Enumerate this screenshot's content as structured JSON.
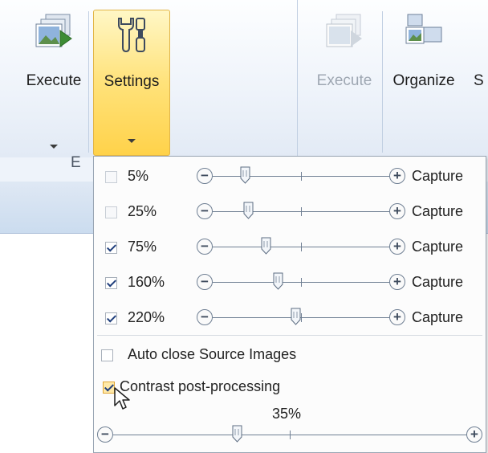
{
  "ribbon": {
    "execute_label": "Execute",
    "settings_label": "Settings",
    "execute2_label": "Execute",
    "organize_label": "Organize",
    "partial_label": "S",
    "group_label_partial": "E"
  },
  "dropdown": {
    "rows": [
      {
        "checked": false,
        "percent": "5%",
        "capture_label": "Capture",
        "level": 0.18
      },
      {
        "checked": false,
        "percent": "25%",
        "capture_label": "Capture",
        "level": 0.2
      },
      {
        "checked": true,
        "percent": "75%",
        "capture_label": "Capture",
        "level": 0.3
      },
      {
        "checked": true,
        "percent": "160%",
        "capture_label": "Capture",
        "level": 0.37
      },
      {
        "checked": true,
        "percent": "220%",
        "capture_label": "Capture",
        "level": 0.47
      }
    ],
    "auto_close_label": "Auto close Source Images",
    "auto_close_checked": false,
    "contrast_label": "Contrast post-processing",
    "contrast_checked": true,
    "contrast_percent": "35%",
    "contrast_level": 0.35
  },
  "colors": {
    "accent": "#ffd24a",
    "track": "#6f7f93",
    "checkmark": "#1f3e7c"
  }
}
